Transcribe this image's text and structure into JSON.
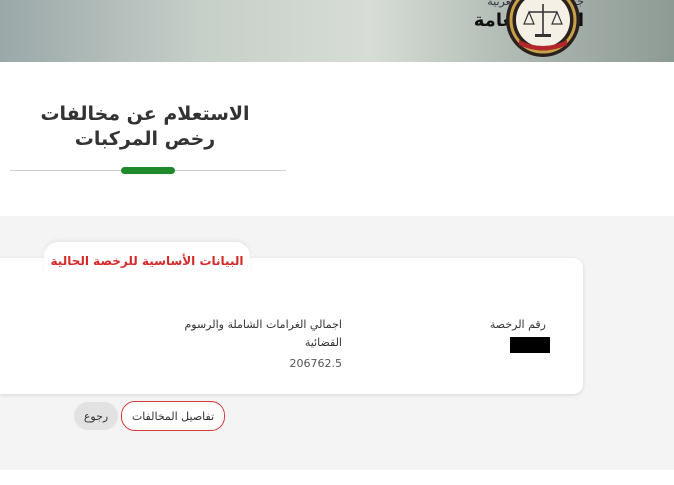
{
  "header": {
    "subtitle": "جمهورية مصر العربية",
    "title": "النيابة العامة"
  },
  "page": {
    "title": "الاستعلام عن مخالفات رخص المركبات"
  },
  "card": {
    "tab_title": "البيانات الأساسية للرخصة الحالية",
    "license_label": "رقم الرخصة",
    "total_label": "اجمالي الغرامات الشاملة والرسوم القضائية",
    "total_value": "206762.5"
  },
  "buttons": {
    "details": "تفاصيل المخالفات",
    "back": "رجوع"
  },
  "colors": {
    "accent_green": "#1f8a2c",
    "tab_red": "#d42a2a",
    "button_border": "#d63a3a"
  }
}
